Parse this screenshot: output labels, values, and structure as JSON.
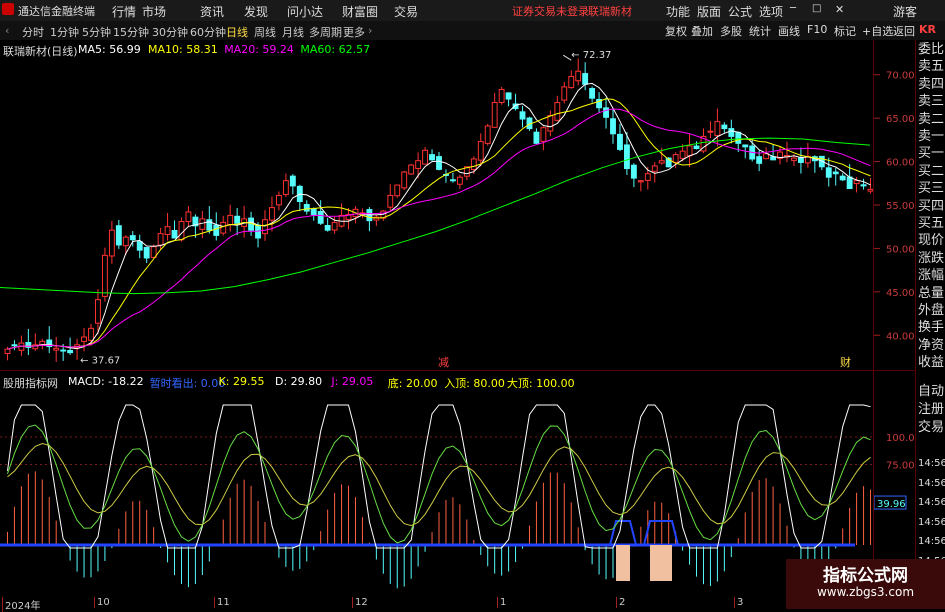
{
  "app": {
    "title": "通达信金融终端",
    "menu": [
      "行情",
      "市场",
      "资讯",
      "发现",
      "问小达",
      "财富圈",
      "交易"
    ],
    "login_notice": "证券交易未登录",
    "stock_link": "联瑞新材",
    "right_menu": [
      "功能",
      "版面",
      "公式",
      "选项"
    ],
    "user": "游客",
    "corner_badge": "KR"
  },
  "periods": [
    "分时",
    "1分钟",
    "5分钟",
    "15分钟",
    "30分钟",
    "60分钟",
    "日线",
    "周线",
    "月线",
    "多周期",
    "更多"
  ],
  "active_period": "日线",
  "toolbar": [
    "复权",
    "叠加",
    "多股",
    "统计",
    "画线",
    "F10",
    "标记",
    "+自选",
    "返回"
  ],
  "main_chart": {
    "title": "联瑞新材(日线)",
    "ma_legend": [
      {
        "label": "MA5: 56.99",
        "color": "#ffffff"
      },
      {
        "label": "MA10: 58.31",
        "color": "#ffff00"
      },
      {
        "label": "MA20: 59.24",
        "color": "#ff00ff"
      },
      {
        "label": "MA60: 62.57",
        "color": "#00ff00"
      }
    ],
    "high_label": "72.37",
    "low_label": "37.67",
    "marker_1": "减",
    "marker_2": "财",
    "y_ticks": [
      "70.00",
      "65.00",
      "60.00",
      "55.00",
      "50.00",
      "45.00",
      "40.00"
    ],
    "y_range": [
      36,
      74
    ],
    "colors": {
      "up": "#ff3232",
      "down": "#54fcfc",
      "ma5": "#ffffff",
      "ma10": "#ffff00",
      "ma20": "#ff00ff",
      "ma60": "#00ff00"
    }
  },
  "sub_chart": {
    "title": "股朋指标网",
    "legend": [
      {
        "label": "MACD: -18.22",
        "color": "#ffffff"
      },
      {
        "label": "暂时看出: 0.00",
        "color": "#3366ff"
      },
      {
        "label": "K: 29.55",
        "color": "#ffff00"
      },
      {
        "label": "D: 29.80",
        "color": "#ffffff"
      },
      {
        "label": "J: 29.05",
        "color": "#ff00ff"
      },
      {
        "label": "底: 20.00",
        "color": "#ffff00"
      },
      {
        "label": "入顶: 80.00",
        "color": "#ffff00"
      },
      {
        "label": "大顶: 100.00",
        "color": "#ffff00"
      }
    ],
    "y_ticks": [
      "100.00",
      "75.00"
    ],
    "current_value": "39.96"
  },
  "date_labels": [
    "2024年",
    "10",
    "11",
    "12",
    "1",
    "2",
    "3"
  ],
  "right_panel": {
    "order_labels": [
      "委比",
      "卖五",
      "卖四",
      "卖三",
      "卖二",
      "卖一",
      "买一",
      "买二",
      "买三",
      "买四",
      "买五",
      "现价",
      "涨跌",
      "涨幅",
      "总量",
      "外盘",
      "换手",
      "净资",
      "收益"
    ],
    "side_labels": [
      "自动",
      "注册",
      "交易"
    ],
    "times": [
      "14:56",
      "14:56",
      "14:56",
      "14:56",
      "14:56",
      "14:56",
      "14:56",
      "14:56"
    ]
  },
  "watermark": {
    "title": "指标公式网",
    "url": "www.zbgs3.com"
  },
  "chart_data": {
    "type": "candlestick",
    "title": "联瑞新材(日线)",
    "ylim": [
      36,
      74
    ],
    "y_ticks": [
      70,
      65,
      60,
      55,
      50,
      45,
      40
    ],
    "annotations": {
      "high": 72.37,
      "low": 37.67
    },
    "close": [
      38.4,
      38.8,
      39.1,
      38.6,
      38.9,
      39.3,
      38.7,
      38.5,
      38.2,
      38.0,
      38.9,
      39.8,
      40.8,
      44.1,
      49.2,
      52.1,
      50.4,
      51.3,
      51.0,
      49.8,
      48.9,
      50.2,
      51.7,
      52.5,
      51.2,
      53.1,
      54.2,
      52.6,
      53.4,
      52.1,
      51.5,
      53.0,
      53.8,
      52.9,
      53.4,
      52.1,
      51.2,
      53.3,
      54.7,
      56.1,
      57.8,
      57.2,
      55.4,
      54.3,
      53.9,
      52.9,
      52.1,
      53.0,
      53.8,
      53.9,
      54.5,
      54.1,
      53.2,
      53.6,
      54.3,
      56.1,
      57.3,
      58.8,
      59.6,
      60.1,
      61.3,
      60.2,
      59.1,
      58.4,
      57.9,
      58.2,
      59.4,
      60.3,
      62.3,
      64.1,
      66.8,
      68.3,
      67.2,
      66.1,
      64.9,
      63.8,
      62.1,
      63.9,
      65.3,
      66.8,
      68.6,
      69.8,
      70.4,
      68.9,
      67.3,
      66.2,
      65.1,
      63.2,
      61.4,
      59.2,
      58.1,
      57.8,
      58.6,
      59.5,
      60.1,
      59.4,
      60.8,
      61.2,
      61.8,
      61.5,
      62.9,
      63.5,
      64.6,
      63.8,
      62.9,
      62.1,
      61.7,
      60.3,
      59.8,
      60.9,
      60.2,
      61.1,
      60.7,
      60.4,
      59.9,
      60.6,
      60.1,
      59.4,
      58.2,
      58.6,
      57.9,
      56.9,
      57.8,
      57.2,
      56.8
    ],
    "ma60_visual": [
      45.5,
      45.3,
      45.1,
      44.9,
      44.8,
      44.9,
      45.1,
      45.6,
      46.4,
      47.3,
      48.4,
      49.5,
      50.7,
      51.9,
      53.3,
      54.8,
      56.3,
      57.9,
      59.3,
      60.5,
      61.5,
      62.2,
      62.6,
      62.7,
      62.6,
      62.2,
      61.9
    ]
  }
}
